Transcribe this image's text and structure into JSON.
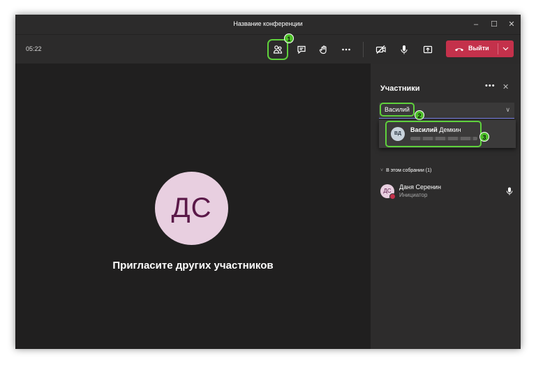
{
  "window": {
    "title": "Название конференции",
    "controls": {
      "minimize": "–",
      "maximize": "☐",
      "close": "✕"
    }
  },
  "toolbar": {
    "timer": "05:22",
    "buttons": [
      "people-icon",
      "chat-icon",
      "raise-hand-icon",
      "more-icon",
      "camera-off-icon",
      "microphone-icon",
      "share-screen-icon"
    ],
    "leave_label": "Выйти",
    "leave_color": "#c4314b"
  },
  "badges": {
    "one": "1",
    "two": "2",
    "three": "3"
  },
  "stage": {
    "avatar_initials": "ДС",
    "invite_text": "Пригласите других участников"
  },
  "participants": {
    "title": "Участники",
    "more": "•••",
    "close": "✕",
    "search_value": "Василий",
    "suggestion": {
      "initials": "ВД",
      "name_bold": "Василий",
      "name_rest": "Демкин"
    },
    "section_label": "В этом собрании (1)",
    "members": [
      {
        "initials": "ДС",
        "name": "Даня Серенин",
        "role": "Инициатор"
      }
    ]
  },
  "colors": {
    "accent": "#7b83eb",
    "highlight": "#5fd13c",
    "badge": "#4ec02a"
  }
}
